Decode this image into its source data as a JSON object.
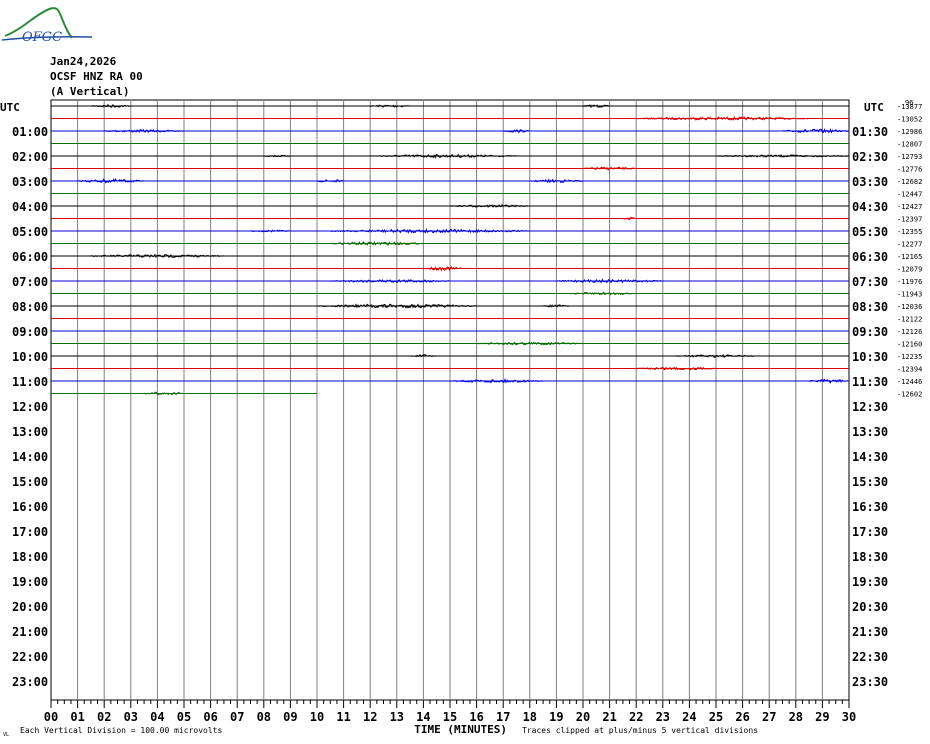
{
  "logo": {
    "text": "OFGC"
  },
  "header": {
    "date": "Jan24,2026",
    "station": "OCSF HNZ RA 00",
    "component": "(A Vertical)"
  },
  "left_utc_label": "UTC",
  "right_utc_label": "UTC",
  "top_right_small": "96",
  "footer": {
    "scale_note": "Each Vertical Division =  100.00 microvolts",
    "xlabel": "TIME (MINUTES)",
    "clip_note": "Traces clipped at plus/minus 5 vertical divisions",
    "corner_mark": "VL"
  },
  "colors": {
    "black": "#000000",
    "red": "#e00000",
    "blue": "#0000e0",
    "green": "#007000",
    "grid": "#808080"
  },
  "chart_data": {
    "type": "line",
    "title": "OCSF HNZ RA 00 (A Vertical)",
    "xlabel": "TIME (MINUTES)",
    "xlim": [
      0,
      30
    ],
    "x_ticks": [
      "00",
      "01",
      "02",
      "03",
      "04",
      "05",
      "06",
      "07",
      "08",
      "09",
      "10",
      "11",
      "12",
      "13",
      "14",
      "15",
      "16",
      "17",
      "18",
      "19",
      "20",
      "21",
      "22",
      "23",
      "24",
      "25",
      "26",
      "27",
      "28",
      "29",
      "30"
    ],
    "left_hour_labels": [
      "01:00",
      "02:00",
      "03:00",
      "04:00",
      "05:00",
      "06:00",
      "07:00",
      "08:00",
      "09:00",
      "10:00",
      "11:00",
      "12:00",
      "13:00",
      "14:00",
      "15:00",
      "16:00",
      "17:00",
      "18:00",
      "19:00",
      "20:00",
      "21:00",
      "22:00",
      "23:00"
    ],
    "right_hour_labels": [
      "01:30",
      "02:30",
      "03:30",
      "04:30",
      "05:30",
      "06:30",
      "07:30",
      "08:30",
      "09:30",
      "10:30",
      "11:30",
      "12:30",
      "13:30",
      "14:30",
      "15:30",
      "16:30",
      "17:30",
      "18:30",
      "19:30",
      "20:30",
      "21:30",
      "22:30",
      "23:30"
    ],
    "trace_colors_cycle": [
      "black",
      "red",
      "blue",
      "green"
    ],
    "trace_offsets": [
      "-13877",
      "-13052",
      "-12986",
      "-12807",
      "-12793",
      "-12776",
      "-12682",
      "-12447",
      "-12427",
      "-12397",
      "-12355",
      "-12277",
      "-12165",
      "-12079",
      "-11976",
      "-11943",
      "-12036",
      "-12122",
      "-12126",
      "-12160",
      "-12235",
      "-12394",
      "-12446",
      "-12602"
    ],
    "last_trace_end_minute": 10,
    "bursts": [
      [
        [
          1.5,
          3.0,
          1.2
        ],
        [
          12.0,
          13.5,
          1.0
        ],
        [
          20.0,
          21.0,
          1.0
        ]
      ],
      [
        [
          22.0,
          28.5,
          1.2
        ]
      ],
      [
        [
          2.0,
          5.0,
          1.0
        ],
        [
          17.0,
          18.0,
          1.0
        ],
        [
          27.5,
          30,
          1.5
        ]
      ],
      [],
      [
        [
          8.0,
          9.0,
          0.6
        ],
        [
          12.0,
          17.5,
          1.2
        ],
        [
          25.0,
          30,
          0.8
        ]
      ],
      [
        [
          20.0,
          22.0,
          1.2
        ]
      ],
      [
        [
          1.0,
          3.5,
          1.5
        ],
        [
          10.0,
          11.0,
          1.3
        ],
        [
          18.0,
          20.0,
          1.2
        ]
      ],
      [],
      [
        [
          15.0,
          18.0,
          1.0
        ]
      ],
      [
        [
          21.5,
          22.0,
          1.0
        ]
      ],
      [
        [
          7.5,
          9.0,
          0.6
        ],
        [
          10.5,
          18.0,
          1.4
        ]
      ],
      [
        [
          10.5,
          14.0,
          1.3
        ]
      ],
      [
        [
          1.5,
          6.5,
          1.2
        ]
      ],
      [
        [
          14.0,
          15.5,
          1.6
        ]
      ],
      [
        [
          10.5,
          15.0,
          1.2
        ],
        [
          19.0,
          23.0,
          1.2
        ]
      ],
      [
        [
          19.5,
          22.0,
          1.0
        ]
      ],
      [
        [
          10.0,
          16.0,
          1.6
        ],
        [
          18.5,
          19.5,
          0.8
        ]
      ],
      [],
      [],
      [
        [
          16.0,
          20.0,
          1.0
        ]
      ],
      [
        [
          13.5,
          14.5,
          1.0
        ],
        [
          23.5,
          26.5,
          1.0
        ]
      ],
      [
        [
          22.0,
          25.0,
          1.2
        ]
      ],
      [
        [
          15.0,
          18.5,
          1.3
        ],
        [
          28.5,
          30,
          1.5
        ]
      ],
      [
        [
          3.5,
          5.0,
          1.2
        ]
      ]
    ]
  }
}
